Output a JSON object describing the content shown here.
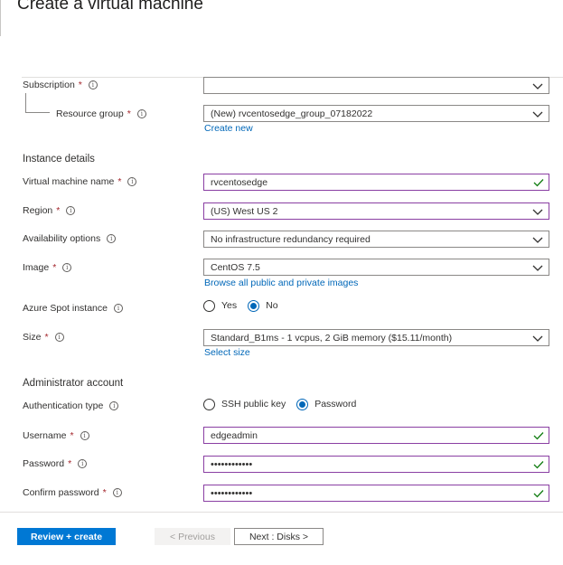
{
  "page": {
    "title": "Create a virtual machine"
  },
  "form": {
    "subscription": {
      "label": "Subscription",
      "value": ""
    },
    "resource_group": {
      "label": "Resource group",
      "value": "(New) rvcentosedge_group_07182022",
      "link": "Create new"
    },
    "instance_details": "Instance details",
    "vm_name": {
      "label": "Virtual machine name",
      "value": "rvcentosedge"
    },
    "region": {
      "label": "Region",
      "value": "(US) West US 2"
    },
    "availability": {
      "label": "Availability options",
      "value": "No infrastructure redundancy required"
    },
    "image": {
      "label": "Image",
      "value": "CentOS 7.5",
      "link": "Browse all public and private images"
    },
    "spot": {
      "label": "Azure Spot instance",
      "options": [
        "Yes",
        "No"
      ],
      "selected": "No"
    },
    "size": {
      "label": "Size",
      "value": "Standard_B1ms - 1 vcpus, 2 GiB memory ($15.11/month)",
      "link": "Select size"
    },
    "admin_account": "Administrator account",
    "auth_type": {
      "label": "Authentication type",
      "options": [
        "SSH public key",
        "Password"
      ],
      "selected": "Password"
    },
    "username": {
      "label": "Username",
      "value": "edgeadmin"
    },
    "password": {
      "label": "Password",
      "value": "••••••••••••"
    },
    "confirm_password": {
      "label": "Confirm password",
      "value": "••••••••••••"
    }
  },
  "footer": {
    "review_create": "Review + create",
    "previous": "< Previous",
    "next": "Next : Disks >"
  },
  "symbols": {
    "required": "*",
    "info": "i"
  },
  "colors": {
    "accent": "#0078d4",
    "link": "#0067b8",
    "active_border": "#8a3fa3",
    "valid_check": "#107c10",
    "required": "#a4262c"
  },
  "icons": {
    "dropdown": "chevron-down-icon",
    "valid": "checkmark-icon",
    "info": "info-icon"
  }
}
